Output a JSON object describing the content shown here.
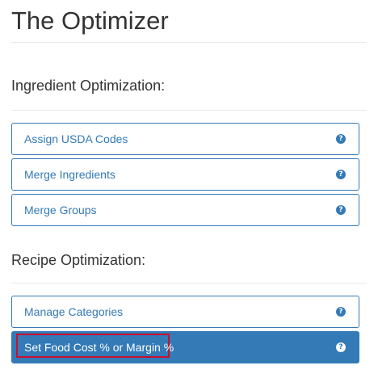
{
  "page": {
    "title": "The Optimizer"
  },
  "ingredient_section": {
    "heading": "Ingredient Optimization:",
    "items": [
      {
        "label": "Assign USDA Codes",
        "icon": "question-circle-icon"
      },
      {
        "label": "Merge Ingredients",
        "icon": "question-circle-icon"
      },
      {
        "label": "Merge Groups",
        "icon": "question-circle-icon"
      }
    ]
  },
  "recipe_section": {
    "heading": "Recipe Optimization:",
    "items": [
      {
        "label": "Manage Categories",
        "icon": "question-circle-icon",
        "active": false
      },
      {
        "label": "Set Food Cost % or Margin %",
        "icon": "question-circle-icon",
        "active": true,
        "highlighted": true
      }
    ]
  },
  "icons": {
    "help_glyph": "?"
  },
  "colors": {
    "accent": "#337ab7",
    "highlight_outline": "#c8102e",
    "text": "#333333",
    "divider": "#e8e8e8"
  }
}
